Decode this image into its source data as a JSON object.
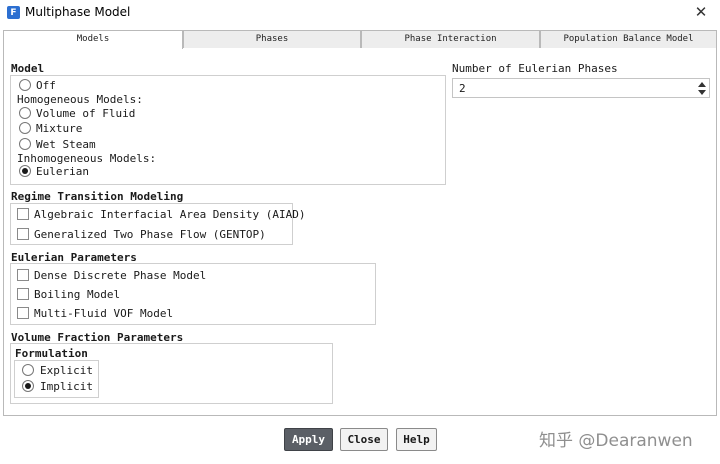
{
  "window": {
    "title": "Multiphase Model",
    "app_icon_glyph": "F",
    "close_glyph": "✕"
  },
  "tabs": [
    {
      "label": "Models",
      "active": true
    },
    {
      "label": "Phases",
      "active": false
    },
    {
      "label": "Phase Interaction",
      "active": false
    },
    {
      "label": "Population Balance Model",
      "active": false
    }
  ],
  "model": {
    "heading": "Model",
    "off": "Off",
    "homogeneous_label": "Homogeneous Models:",
    "volume_of_fluid": "Volume of Fluid",
    "mixture": "Mixture",
    "wet_steam": "Wet Steam",
    "inhomogeneous_label": "Inhomogeneous Models:",
    "eulerian": "Eulerian",
    "selected": "Eulerian"
  },
  "eulerian_phases": {
    "label": "Number of Eulerian Phases",
    "value": "2"
  },
  "regime": {
    "heading": "Regime Transition Modeling",
    "aiad": "Algebraic Interfacial Area Density (AIAD)",
    "gentop": "Generalized Two Phase Flow (GENTOP)"
  },
  "eulerian_params": {
    "heading": "Eulerian Parameters",
    "ddpm": "Dense Discrete Phase Model",
    "boiling": "Boiling Model",
    "multi_fluid_vof": "Multi-Fluid VOF Model"
  },
  "volume_fraction": {
    "heading": "Volume Fraction Parameters",
    "formulation_heading": "Formulation",
    "explicit": "Explicit",
    "implicit": "Implicit",
    "selected": "Implicit"
  },
  "buttons": {
    "apply": "Apply",
    "close": "Close",
    "help": "Help"
  },
  "watermark": "知乎 @Dearanwen",
  "colors": {
    "accent": "#2c6fd1",
    "primary_button": "#5b5f66"
  }
}
